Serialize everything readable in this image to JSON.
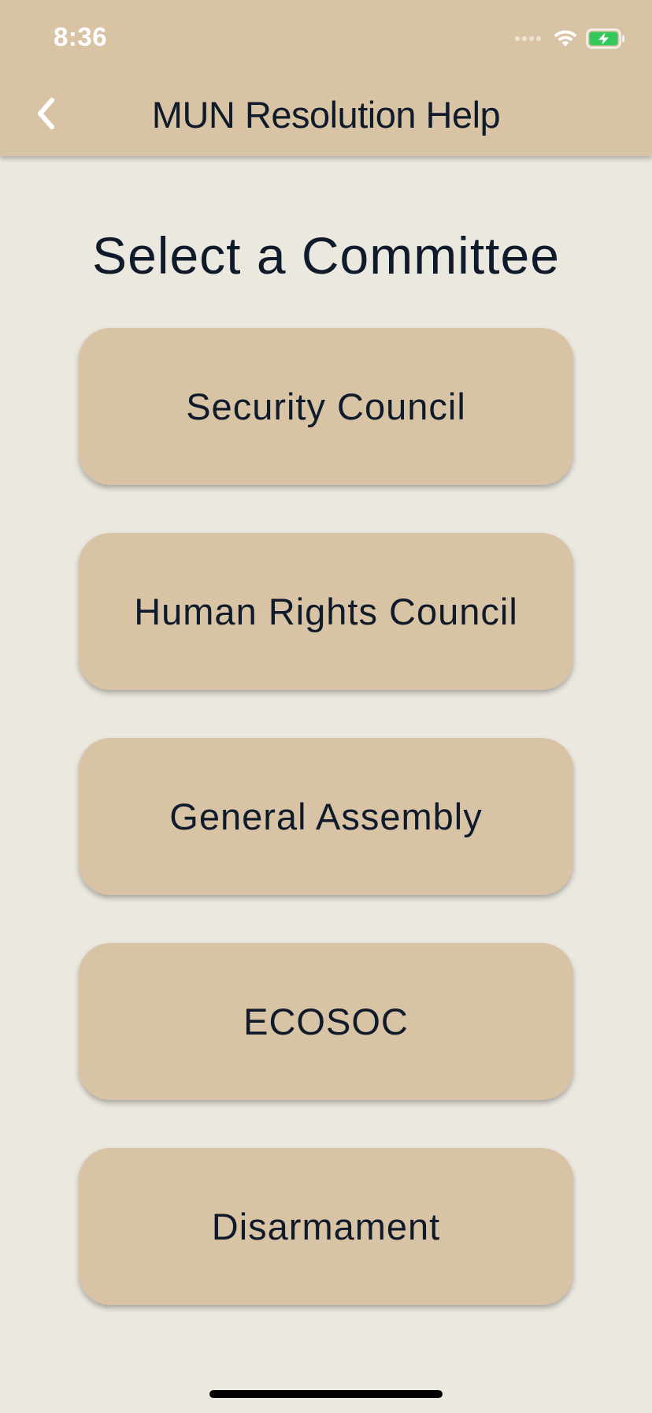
{
  "status_bar": {
    "time": "8:36",
    "icons": [
      "signal-dots-icon",
      "wifi-icon",
      "battery-charging-icon"
    ],
    "battery_color": "#34c759"
  },
  "nav": {
    "title": "MUN Resolution Help",
    "back_icon": "chevron-left-icon"
  },
  "main": {
    "heading": "Select a Committee",
    "committees": [
      {
        "label": "Security Council"
      },
      {
        "label": "Human Rights Council"
      },
      {
        "label": "General Assembly"
      },
      {
        "label": "ECOSOC"
      },
      {
        "label": "Disarmament"
      }
    ]
  },
  "colors": {
    "bar_background": "#d9c3a5",
    "page_background": "#ebe8df",
    "text": "#0f1a2b"
  }
}
